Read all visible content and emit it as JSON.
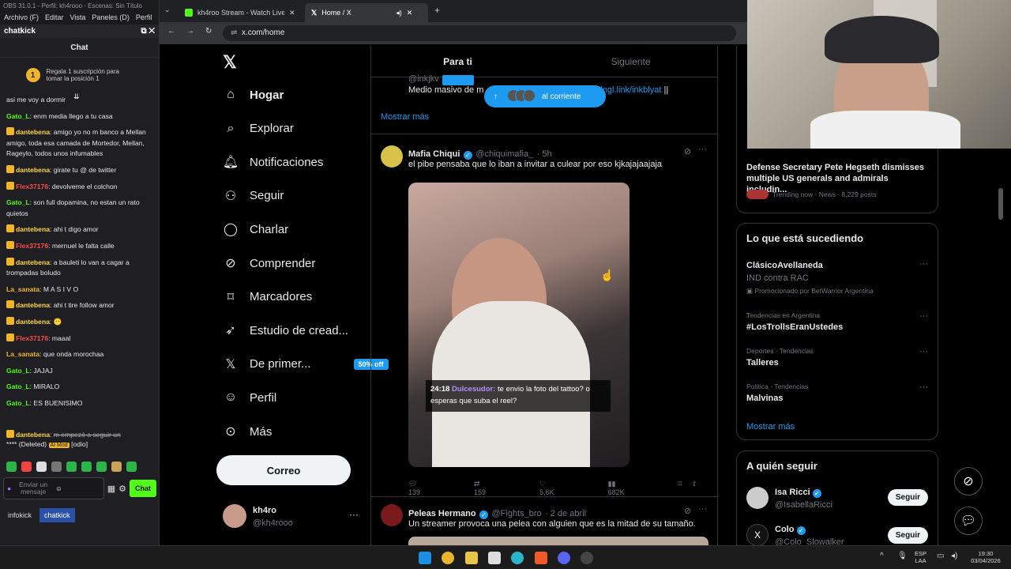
{
  "obs": {
    "title": "OBS 31.0.1 - Perfil: kh4rooo - Escenas: Sin Título",
    "menu": [
      "Archivo (F)",
      "Editar",
      "Vista",
      "Paneles (D)",
      "Perfil"
    ],
    "dock_title": "chatkick",
    "chat_title": "Chat",
    "pinned": "Regala 1 suscripción para tomar la posición 1",
    "pinned_rank": "1",
    "messages": [
      {
        "user": "",
        "text": "asi me voy a dormir",
        "color": "none"
      },
      {
        "user": "Gato_L",
        "text": ": enm media llego a tu casa",
        "color": "u1"
      },
      {
        "user": "dantebena",
        "text": ": amigo yo no m banco a Mellan amigo, toda esa camada de Mortedor, Mellan, Rageylo, todos unos infumables",
        "color": "u2",
        "badge": true
      },
      {
        "user": "dantebena",
        "text": ": girate tu @ de twitter",
        "color": "u2",
        "badge": true
      },
      {
        "user": "Flex37176",
        "text": ": devolveme el colchon",
        "color": "u3",
        "badge": true
      },
      {
        "user": "Gato_L",
        "text": ": son full dopamina, no estan un rato quietos",
        "color": "u1"
      },
      {
        "user": "dantebena",
        "text": ": ahi t digo amor",
        "color": "u2",
        "badge": true
      },
      {
        "user": "Flex37176",
        "text": ": mernuel le falta calle",
        "color": "u3",
        "badge": true
      },
      {
        "user": "dantebena",
        "text": ": a bauleti lo van a cagar a trompadas boludo",
        "color": "u2",
        "badge": true
      },
      {
        "user": "La_sanata",
        "text": ": M A S I V O",
        "color": "u4"
      },
      {
        "user": "dantebena",
        "text": ": ahi t tire follow amor",
        "color": "u2",
        "badge": true
      },
      {
        "user": "dantebena",
        "text": ": 😶",
        "color": "u2",
        "badge": true
      },
      {
        "user": "Flex37176",
        "text": ": maaal",
        "color": "u3",
        "badge": true
      },
      {
        "user": "La_sanata",
        "text": ": que onda morochaa",
        "color": "u4"
      },
      {
        "user": "Gato_L",
        "text": ": JAJAJ",
        "color": "u1"
      },
      {
        "user": "Gato_L",
        "text": ": MIRALO",
        "color": "u1"
      },
      {
        "user": "Gato_L",
        "text": ": ES BUENISIMO",
        "color": "u1"
      }
    ],
    "deleted": {
      "user": "dantebena",
      "text": "m empezó a seguir un",
      "tail": "**** (Deleted)",
      "mod": "AI Mod",
      "odio": "[odio]"
    },
    "input_placeholder": "Enviar un mensaje",
    "send": "Chat",
    "tabs": [
      "infokick",
      "chatkick"
    ]
  },
  "browser": {
    "tab1": "kh4roo Stream - Watch Live on",
    "tab2": "Home / X",
    "url": "x.com/home"
  },
  "x": {
    "nav": [
      {
        "label": "Hogar",
        "icon": "home-icon"
      },
      {
        "label": "Explorar",
        "icon": "search-icon"
      },
      {
        "label": "Notificaciones",
        "icon": "bell-icon"
      },
      {
        "label": "Seguir",
        "icon": "add-user-icon"
      },
      {
        "label": "Charlar",
        "icon": "chat-icon"
      },
      {
        "label": "Comprender",
        "icon": "grok-icon"
      },
      {
        "label": "Marcadores",
        "icon": "bookmark-icon"
      },
      {
        "label": "Estudio de cread...",
        "icon": "rocket-icon"
      },
      {
        "label": "De primer...",
        "icon": "x-icon"
      },
      {
        "label": "Perfil",
        "icon": "person-icon"
      },
      {
        "label": "Más",
        "icon": "more-icon"
      }
    ],
    "premium_badge": "50% off",
    "post_button": "Correo",
    "account_name": "kh4ro",
    "account_handle": "@kh4rooo",
    "tabs": [
      "Para ti",
      "Siguiente"
    ],
    "post0": {
      "handle": "@inkjkv",
      "text_start": "Medio masivo de m",
      "link": "lngl.link/inkblyat",
      "tail": "||",
      "more": "Mostrar más"
    },
    "toast": "al corriente",
    "post1": {
      "name": "Mafia Chiqui",
      "handle": "@chiquimafia_",
      "time": "· 5h",
      "text": "el pibe pensaba que lo iban a invitar a culear por eso kjkajajaajaja",
      "caption_time": "24:18",
      "caption_user": "Dulcesudor:",
      "caption_text": "te envio la foto del tattoo? o esperas que suba el reel?",
      "replies": "139",
      "reposts": "159",
      "likes": "5,6K",
      "views": "682K"
    },
    "post2": {
      "name": "Peleas Hermano",
      "handle": "@Fights_bro",
      "time": "· 2 de abril",
      "text": "Un streamer provoca una pelea con alguien que es la mitad de su tamaño."
    },
    "news": {
      "title": "Defense Secretary Pete Hegseth dismisses multiple US generals and admirals includin...",
      "meta": "Trending now · News · 8,229 posts"
    },
    "happening": {
      "title": "Lo que está sucediendo",
      "items": [
        {
          "meta": "",
          "name": "ClásicoAvellaneda",
          "sub": "IND contra RAC",
          "promo": "Promocionado por BetWarrior Argentina"
        },
        {
          "meta": "Tendencias en Argentina",
          "name": "#LosTrollsEranUstedes"
        },
        {
          "meta": "Deportes · Tendencias",
          "name": "Talleres"
        },
        {
          "meta": "Política · Tendencias",
          "name": "Malvinas"
        }
      ],
      "more": "Mostrar más"
    },
    "who": {
      "title": "A quién seguir",
      "items": [
        {
          "name": "Isa Ricci",
          "handle": "@IsabellaRicci",
          "btn": "Seguir"
        },
        {
          "name": "Colo",
          "handle": "@Colo_Slowalker",
          "btn": "Seguir"
        }
      ]
    }
  },
  "taskbar": {
    "lang": "ESP",
    "lang2": "LAA",
    "time": "19:30",
    "date": "03/04/2026"
  },
  "colors": {
    "accent": "#1d9bf0",
    "kick": "#53fc18"
  }
}
